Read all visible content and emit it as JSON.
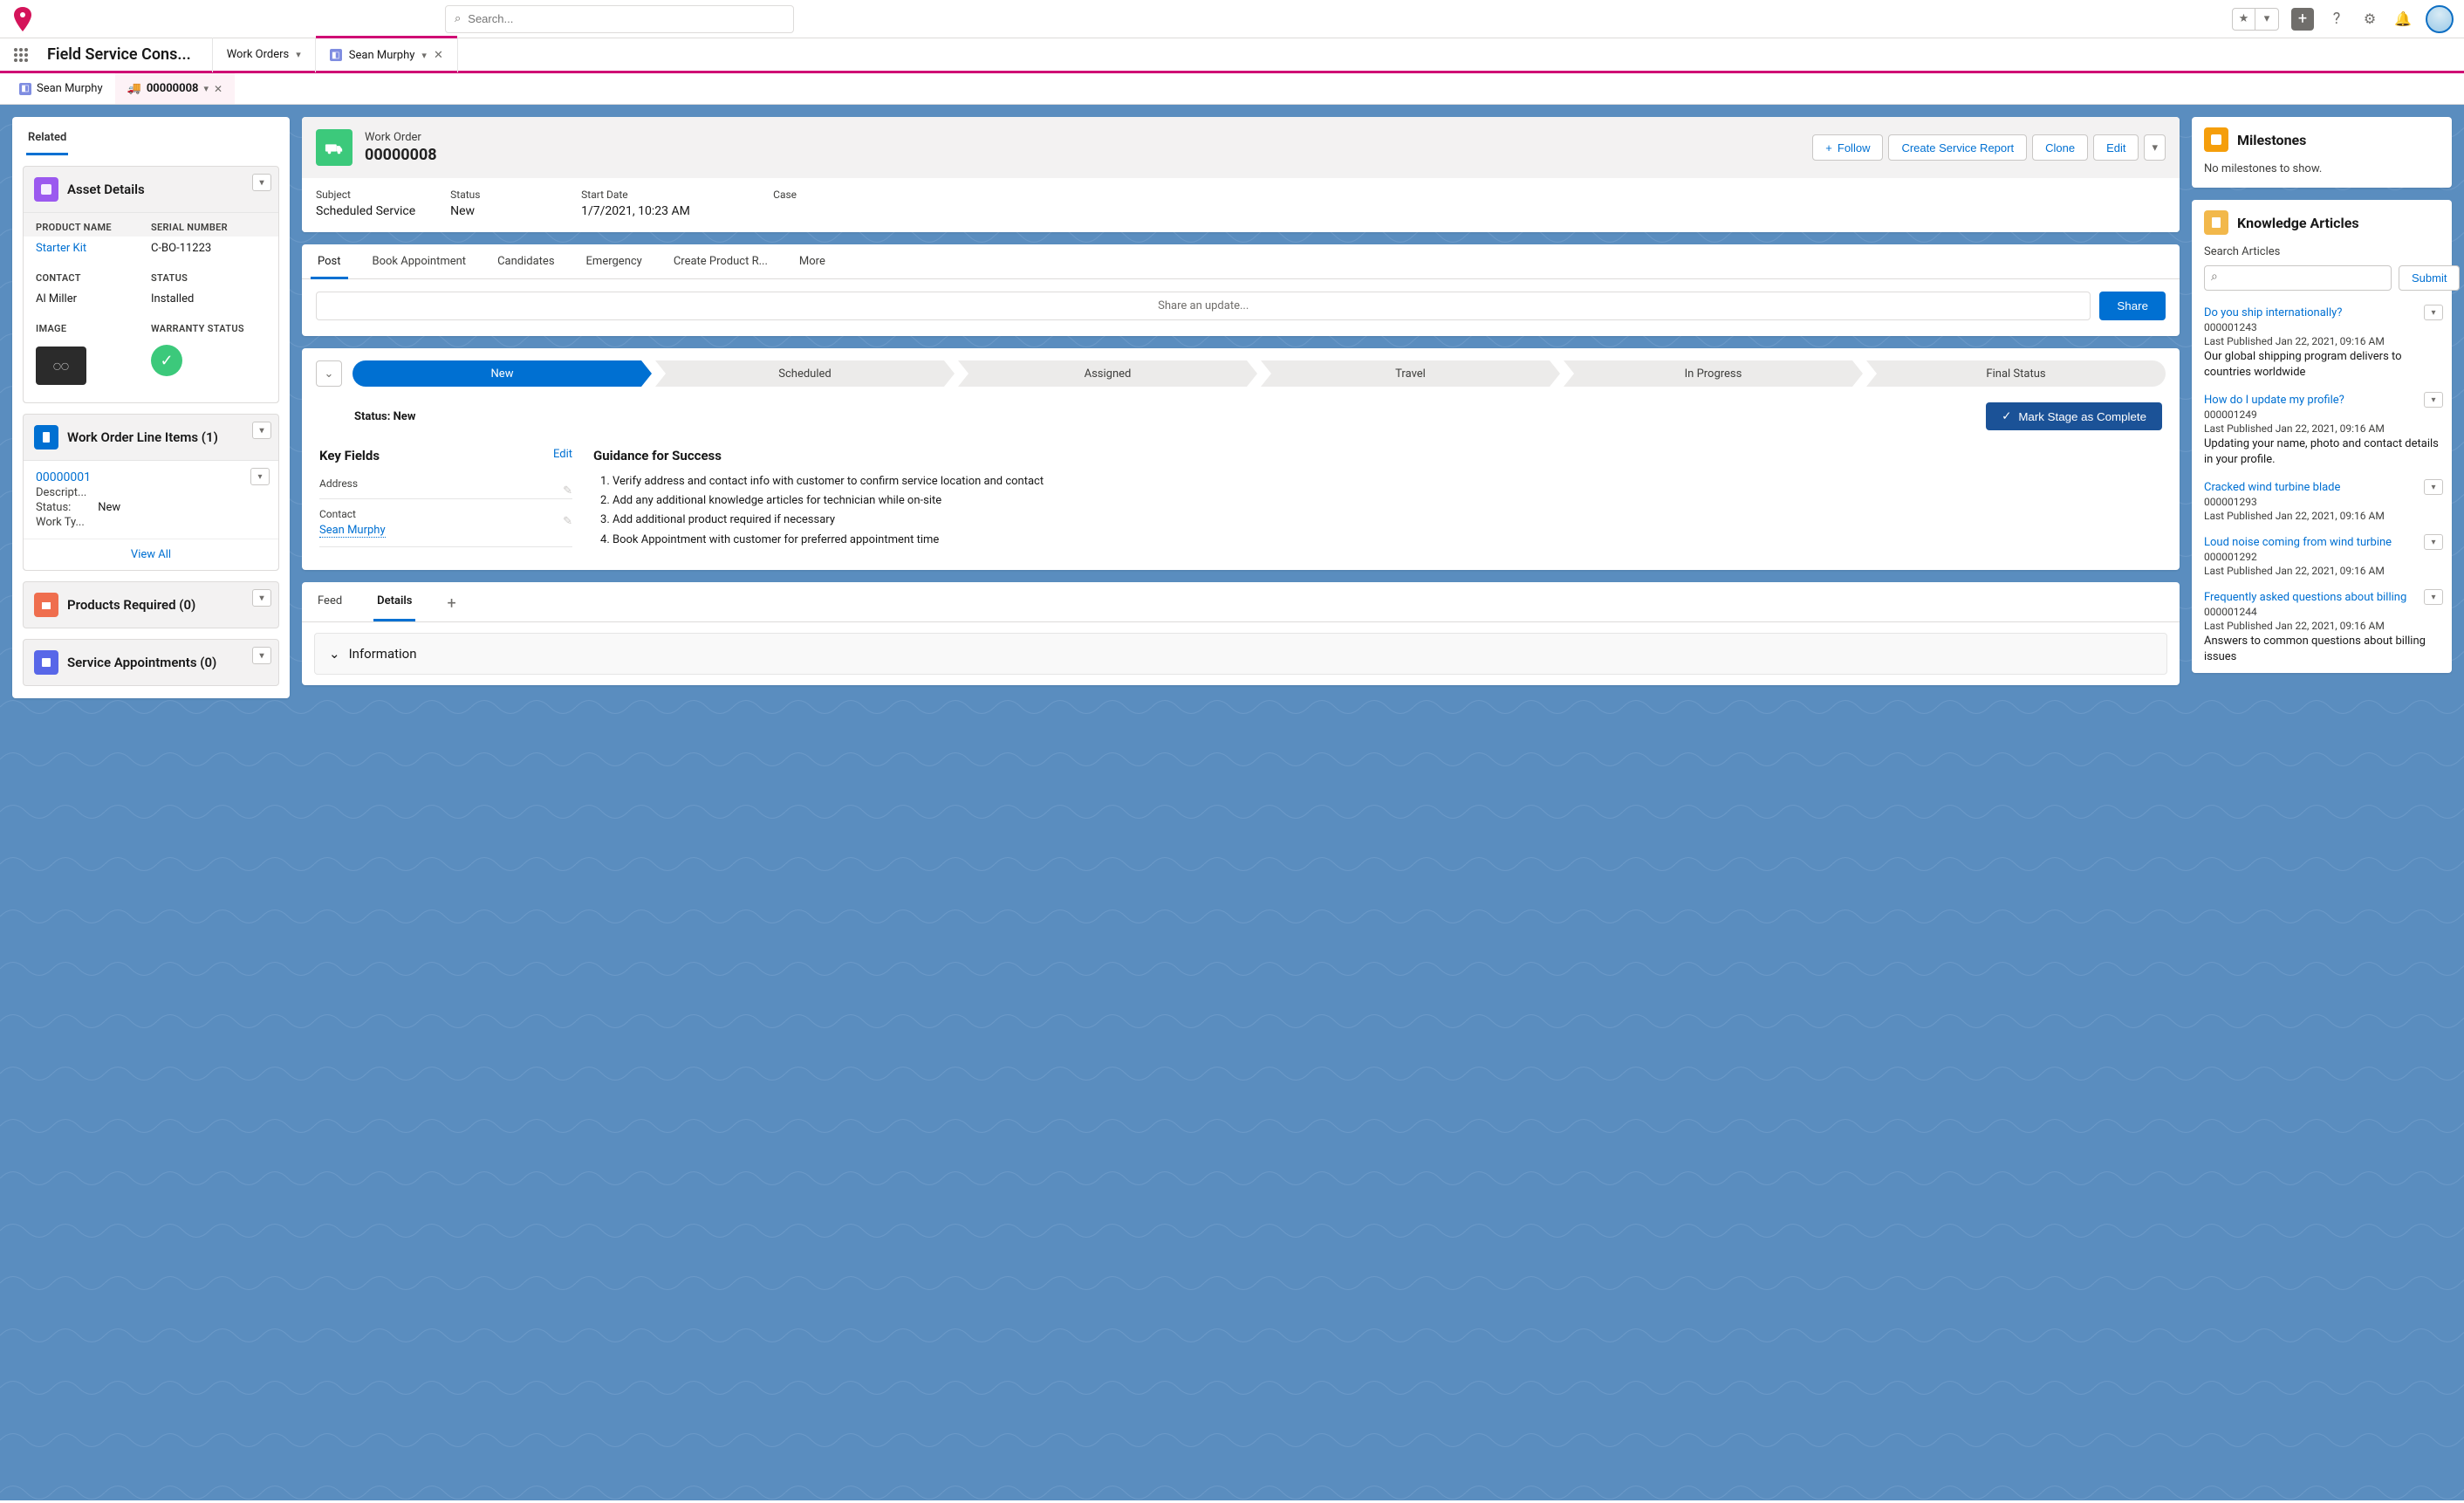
{
  "header": {
    "search_placeholder": "Search...",
    "app_name": "Field Service Cons..."
  },
  "nav_tabs": [
    {
      "label": "Work Orders",
      "closable": false
    },
    {
      "label": "Sean Murphy",
      "closable": true,
      "icon": "contact",
      "active": true
    }
  ],
  "subtabs": [
    {
      "label": "Sean Murphy",
      "icon": "contact"
    },
    {
      "label": "00000008",
      "icon": "truck",
      "active": true
    }
  ],
  "related": {
    "tab": "Related",
    "asset_details": {
      "title": "Asset Details",
      "product_name_label": "PRODUCT NAME",
      "product_name": "Starter Kit",
      "serial_label": "SERIAL NUMBER",
      "serial": "C-BO-11223",
      "contact_label": "CONTACT",
      "contact": "Al Miller",
      "status_label": "STATUS",
      "status": "Installed",
      "image_label": "IMAGE",
      "warranty_label": "WARRANTY STATUS"
    },
    "woli": {
      "title": "Work Order Line Items (1)",
      "item_number": "00000001",
      "desc_label": "Descript...",
      "status_label": "Status:",
      "status_value": "New",
      "worktype_label": "Work Ty...",
      "view_all": "View All"
    },
    "products_required": {
      "title": "Products Required (0)"
    },
    "service_appointments": {
      "title": "Service Appointments (0)"
    }
  },
  "work_order": {
    "type_label": "Work Order",
    "number": "00000008",
    "actions": {
      "follow": "Follow",
      "create_report": "Create Service Report",
      "clone": "Clone",
      "edit": "Edit"
    },
    "fields": {
      "subject_l": "Subject",
      "subject_v": "Scheduled Service",
      "status_l": "Status",
      "status_v": "New",
      "start_l": "Start Date",
      "start_v": "1/7/2021, 10:23 AM",
      "case_l": "Case",
      "case_v": ""
    }
  },
  "activity_tabs": [
    "Post",
    "Book Appointment",
    "Candidates",
    "Emergency",
    "Create Product R...",
    "More"
  ],
  "share": {
    "placeholder": "Share an update...",
    "button": "Share"
  },
  "path": {
    "stages": [
      "New",
      "Scheduled",
      "Assigned",
      "Travel",
      "In Progress",
      "Final Status"
    ],
    "current": "New",
    "status_prefix": "Status:",
    "status_value": "New",
    "mark_complete": "Mark Stage as Complete",
    "key_fields_title": "Key Fields",
    "edit_label": "Edit",
    "address_label": "Address",
    "contact_label": "Contact",
    "contact_value": "Sean Murphy",
    "guidance_title": "Guidance for Success",
    "guidance_steps": [
      "Verify address and contact info with customer to confirm service location and contact",
      "Add any additional knowledge articles for technician while on-site",
      "Add additional product required if necessary",
      "Book Appointment with customer for preferred appointment time"
    ]
  },
  "detail_tabs": {
    "feed": "Feed",
    "details": "Details",
    "add": "+"
  },
  "detail_section": "Information",
  "milestones": {
    "title": "Milestones",
    "empty": "No milestones to show."
  },
  "knowledge": {
    "title": "Knowledge Articles",
    "search_label": "Search Articles",
    "submit": "Submit",
    "articles": [
      {
        "title": "Do you ship internationally?",
        "num": "000001243",
        "pub": "Last Published Jan 22, 2021, 09:16 AM",
        "desc": "Our global shipping program delivers to countries worldwide"
      },
      {
        "title": "How do I update my profile?",
        "num": "000001249",
        "pub": "Last Published Jan 22, 2021, 09:16 AM",
        "desc": "Updating your name, photo and contact details in your profile."
      },
      {
        "title": "Cracked wind turbine blade",
        "num": "000001293",
        "pub": "Last Published Jan 22, 2021, 09:16 AM",
        "desc": ""
      },
      {
        "title": "Loud noise coming from wind turbine",
        "num": "000001292",
        "pub": "Last Published Jan 22, 2021, 09:16 AM",
        "desc": ""
      },
      {
        "title": "Frequently asked questions about billing",
        "num": "000001244",
        "pub": "Last Published Jan 22, 2021, 09:16 AM",
        "desc": "Answers to common questions about billing issues"
      }
    ]
  }
}
